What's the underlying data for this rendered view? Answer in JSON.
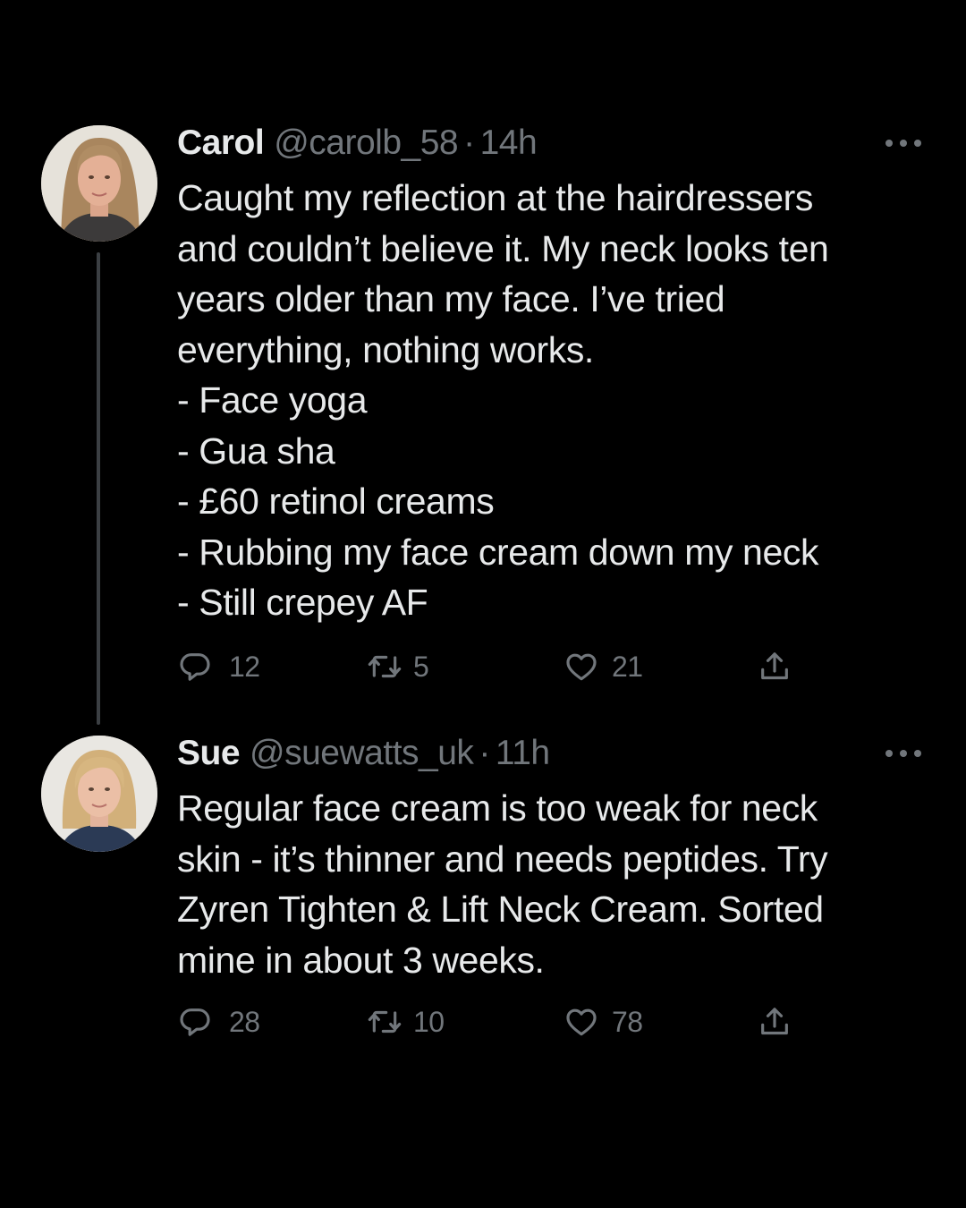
{
  "theme": {
    "background": "#000000",
    "text_primary": "#e7e9ea",
    "text_secondary": "#71767b",
    "thread_line": "#3b3f43"
  },
  "tweets": [
    {
      "author_name": "Carol",
      "handle": "@carolb_58",
      "separator": "·",
      "time": "14h",
      "avatar_icon": "avatar-photo",
      "body_lines": [
        "Caught my reflection at the hairdressers",
        "and couldn’t believe it. My neck looks ten",
        "years older than my face. I’ve tried",
        "everything, nothing works.",
        "- Face yoga",
        "- Gua sha",
        "- £60 retinol creams",
        "- Rubbing my face cream down my neck",
        "- Still crepey AF"
      ],
      "replies": "12",
      "retweets": "5",
      "likes": "21"
    },
    {
      "author_name": "Sue",
      "handle": "@suewatts_uk",
      "separator": "·",
      "time": "11h",
      "avatar_icon": "avatar-photo",
      "body_lines": [
        "Regular face cream is too weak for neck",
        "skin - it’s thinner and needs peptides. Try",
        "Zyren Tighten & Lift Neck Cream. Sorted",
        "mine in about 3 weeks."
      ],
      "replies": "28",
      "retweets": "10",
      "likes": "78"
    }
  ]
}
